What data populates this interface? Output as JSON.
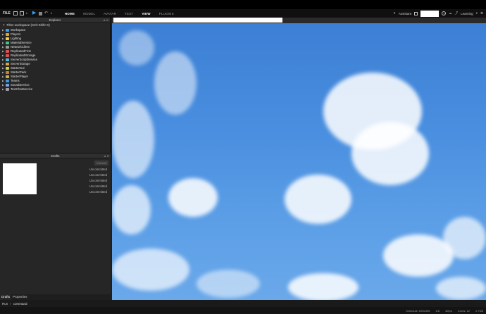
{
  "menubar": {
    "file_label": "FILE",
    "tabs": [
      {
        "label": "HOME",
        "active": true
      },
      {
        "label": "MODEL",
        "active": false
      },
      {
        "label": "AVATAR",
        "active": false
      },
      {
        "label": "TEST",
        "active": false
      },
      {
        "label": "VIEW",
        "active": true
      },
      {
        "label": "PLUGINS",
        "active": false
      }
    ],
    "assistant_label": "Assistant",
    "user_label": "Learning"
  },
  "explorer": {
    "title": "Explorer",
    "filter_label": "Filter workspace (Ctrl+Shift+X)",
    "items": [
      {
        "label": "Workspace",
        "color": "#3aa0e8"
      },
      {
        "label": "Players",
        "color": "#e8a13a"
      },
      {
        "label": "Lighting",
        "color": "#f0d040"
      },
      {
        "label": "MaterialService",
        "color": "#4ac08a"
      },
      {
        "label": "NetworkClient",
        "color": "#9a9a9a"
      },
      {
        "label": "ReplicatedFirst",
        "color": "#e05050"
      },
      {
        "label": "ReplicatedStorage",
        "color": "#e05050"
      },
      {
        "label": "ServerScriptService",
        "color": "#4ab8e0"
      },
      {
        "label": "ServerStorage",
        "color": "#e0a040"
      },
      {
        "label": "StarterGui",
        "color": "#d0d040"
      },
      {
        "label": "StarterPack",
        "color": "#c08040"
      },
      {
        "label": "StarterPlayer",
        "color": "#d0b040"
      },
      {
        "label": "Teams",
        "color": "#3a9ae0"
      },
      {
        "label": "SoundService",
        "color": "#80a0e0"
      },
      {
        "label": "TextChatService",
        "color": "#a0a0a0"
      }
    ]
  },
  "drafts": {
    "title": "Drafts",
    "commit_label": "Commit",
    "entries": [
      "Uncommitted",
      "Uncommitted",
      "Uncommitted",
      "Uncommitted",
      "Uncommitted"
    ]
  },
  "bottom_tabs": [
    {
      "label": "Drafts",
      "active": true
    },
    {
      "label": "Properties",
      "active": false
    }
  ],
  "command": {
    "run_label": "Run",
    "placeholder": "command"
  },
  "status": {
    "schedule": "Schedule: 695x395",
    "s1": "1/8",
    "fps": "40fps",
    "cores": "Cores: 12",
    "mem": "2.7KB"
  }
}
